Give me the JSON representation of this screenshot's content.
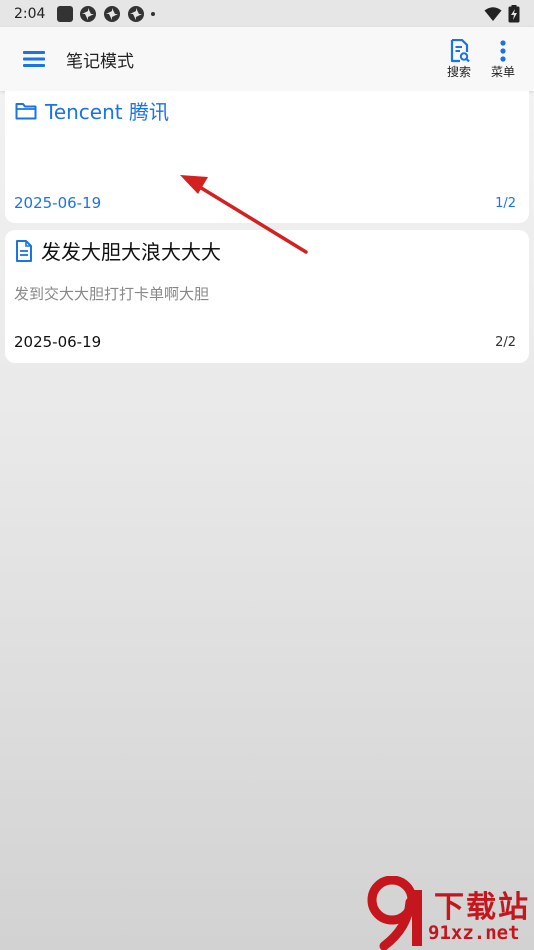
{
  "status_bar": {
    "time": "2:04",
    "icons": [
      "notification-square-icon",
      "pinwheel-icon",
      "pinwheel-icon",
      "pinwheel-icon",
      "dot-icon"
    ],
    "right_icons": [
      "wifi-icon",
      "battery-charging-icon"
    ]
  },
  "app_bar": {
    "title": "笔记模式",
    "search_label": "搜索",
    "menu_label": "菜单",
    "menu_icon": "hamburger-icon",
    "search_icon": "document-search-icon",
    "more_icon": "more-vertical-icon"
  },
  "notes": [
    {
      "type": "folder",
      "icon": "folder-icon",
      "title": "Tencent 腾讯",
      "preview": "",
      "date": "2025-06-19",
      "page": "1/2",
      "color": "#1a73e8"
    },
    {
      "type": "note",
      "icon": "document-icon",
      "title": "发发大胆大浪大大大",
      "preview": "发到交大大胆打打卡单啊大胆",
      "date": "2025-06-19",
      "page": "2/2",
      "color": "#111111"
    }
  ],
  "watermark": {
    "main": "下载站",
    "sub": "91xz.net"
  },
  "colors": {
    "accent": "#1a73e8",
    "annotation_arrow": "#d42020",
    "watermark": "#c4161c"
  }
}
